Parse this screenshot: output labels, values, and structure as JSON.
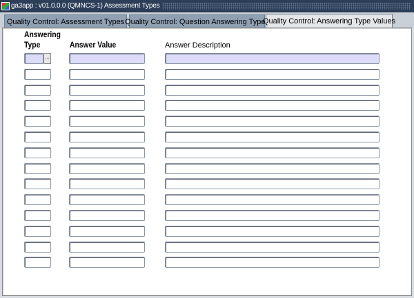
{
  "window": {
    "title": "ga3app : v01.0.0.0 (QMNCS-1) Assessment Types"
  },
  "tabs": [
    {
      "label": "Quality Control: Assessment Types",
      "active": false
    },
    {
      "label": "Quality Control: Question Answering Types",
      "active": false
    },
    {
      "label": "Quality Control: Answering Type Values",
      "active": true
    }
  ],
  "columns": {
    "type_line1": "Answering",
    "type_line2": "Type",
    "value": "Answer Value",
    "description": "Answer Description"
  },
  "lov_button": "...",
  "rows": [
    {
      "type": "",
      "value": "",
      "description": ""
    },
    {
      "type": "",
      "value": "",
      "description": ""
    },
    {
      "type": "",
      "value": "",
      "description": ""
    },
    {
      "type": "",
      "value": "",
      "description": ""
    },
    {
      "type": "",
      "value": "",
      "description": ""
    },
    {
      "type": "",
      "value": "",
      "description": ""
    },
    {
      "type": "",
      "value": "",
      "description": ""
    },
    {
      "type": "",
      "value": "",
      "description": ""
    },
    {
      "type": "",
      "value": "",
      "description": ""
    },
    {
      "type": "",
      "value": "",
      "description": ""
    },
    {
      "type": "",
      "value": "",
      "description": ""
    },
    {
      "type": "",
      "value": "",
      "description": ""
    },
    {
      "type": "",
      "value": "",
      "description": ""
    },
    {
      "type": "",
      "value": "",
      "description": ""
    }
  ]
}
